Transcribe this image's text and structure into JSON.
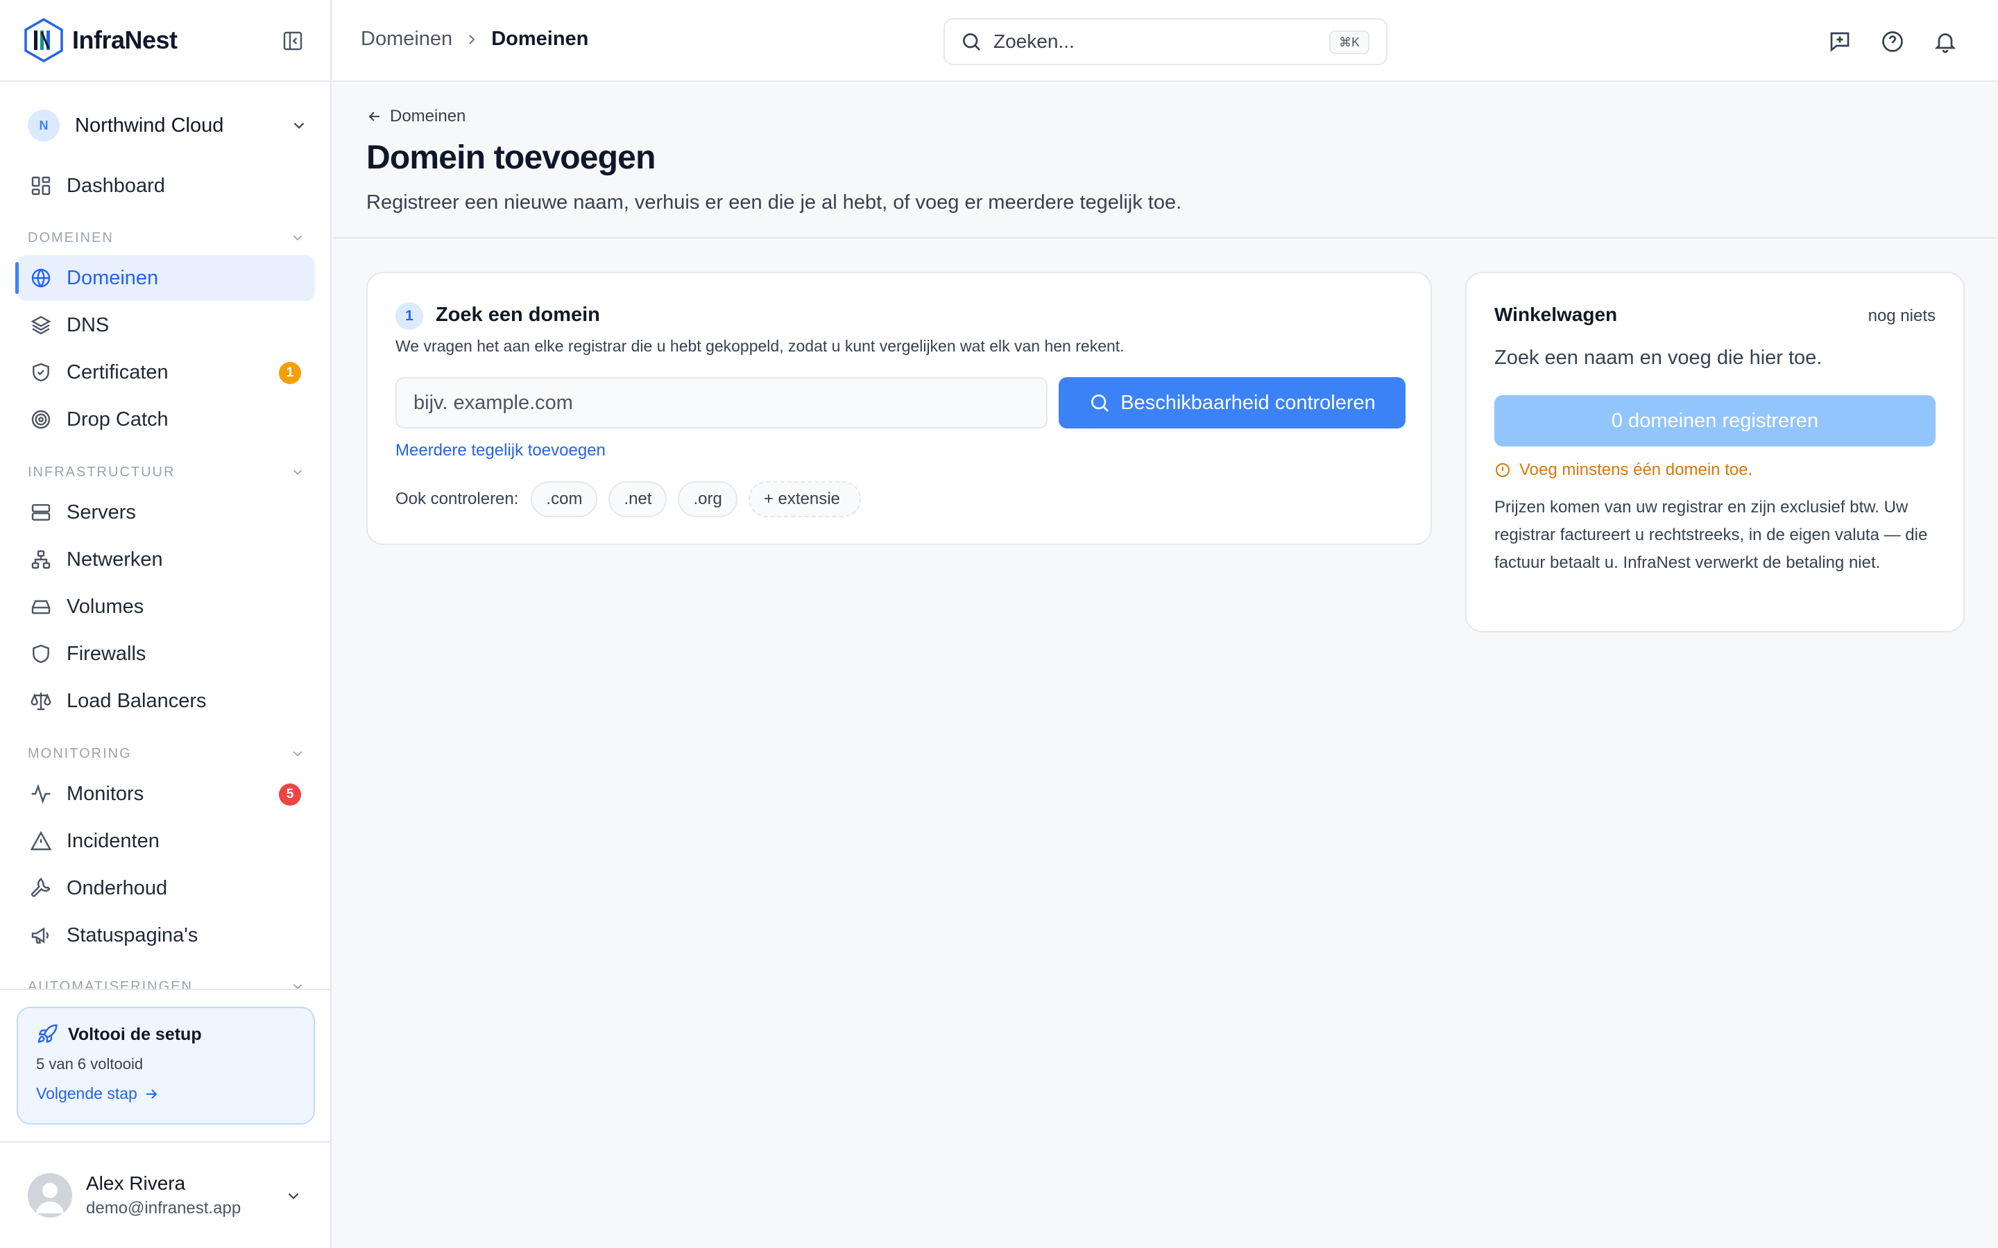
{
  "app": {
    "name": "InfraNest"
  },
  "colors": {
    "accent": "#3b82f6",
    "warning": "#f59e0b",
    "danger": "#ef4444"
  },
  "org": {
    "initial": "N",
    "name": "Northwind Cloud"
  },
  "sidebar": {
    "dashboard": "Dashboard",
    "sections": {
      "domains": "DOMEINEN",
      "infra": "INFRASTRUCTUUR",
      "monitoring": "MONITORING",
      "automation": "AUTOMATISERINGEN"
    },
    "items": {
      "domains": "Domeinen",
      "dns": "DNS",
      "certificates": "Certificaten",
      "certificates_badge": "1",
      "dropcatch": "Drop Catch",
      "servers": "Servers",
      "networks": "Netwerken",
      "volumes": "Volumes",
      "firewalls": "Firewalls",
      "loadbalancers": "Load Balancers",
      "monitors": "Monitors",
      "monitors_badge": "5",
      "incidents": "Incidenten",
      "maintenance": "Onderhoud",
      "statuspages": "Statuspagina's"
    },
    "setup": {
      "title": "Voltooi de setup",
      "progress": "5 van 6 voltooid",
      "next": "Volgende stap"
    },
    "user": {
      "name": "Alex Rivera",
      "email": "demo@infranest.app"
    }
  },
  "topbar": {
    "breadcrumb": [
      "Domeinen",
      "Domeinen"
    ],
    "search_placeholder": "Zoeken...",
    "search_shortcut": "⌘K"
  },
  "page": {
    "back": "Domeinen",
    "title": "Domein toevoegen",
    "subtitle": "Registreer een nieuwe naam, verhuis er een die je al hebt, of voeg er meerdere tegelijk toe."
  },
  "search_card": {
    "step": "1",
    "title": "Zoek een domein",
    "description": "We vragen het aan elke registrar die u hebt gekoppeld, zodat u kunt vergelijken wat elk van hen rekent.",
    "input_placeholder": "bijv. example.com",
    "check_button": "Beschikbaarheid controleren",
    "multi_link": "Meerdere tegelijk toevoegen",
    "also_label": "Ook controleren:",
    "tlds": [
      ".com",
      ".net",
      ".org"
    ],
    "add_extension": "+ extensie"
  },
  "cart": {
    "title": "Winkelwagen",
    "status": "nog niets",
    "hint": "Zoek een naam en voeg die hier toe.",
    "register_button": "0 domeinen registreren",
    "warning": "Voeg minstens één domein toe.",
    "note": "Prijzen komen van uw registrar en zijn exclusief btw. Uw registrar factureert u rechtstreeks, in de eigen valuta — die factuur betaalt u. InfraNest verwerkt de betaling niet."
  }
}
